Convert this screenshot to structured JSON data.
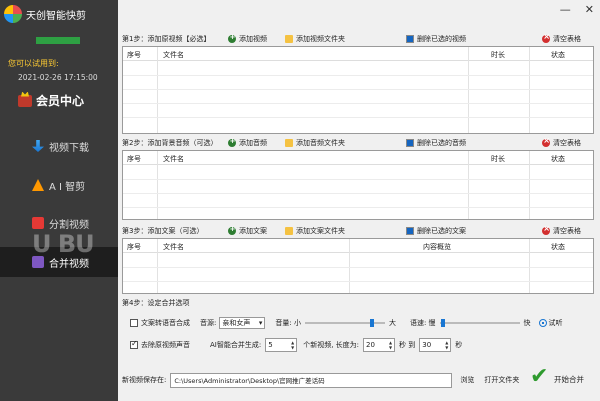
{
  "app": {
    "title": "天创智能快剪"
  },
  "sidebar": {
    "trial_label": "您可以试用到:",
    "trial_date": "2021-02-26 17:15:00",
    "vip_label": "会员中心",
    "items": [
      {
        "label": "视频下载",
        "icon": "download-icon"
      },
      {
        "label": "A I 智剪",
        "icon": "ai-icon"
      },
      {
        "label": "分割视频",
        "icon": "split-icon"
      },
      {
        "label": "合并视频",
        "icon": "merge-icon",
        "active": true
      }
    ],
    "watermark": "U BU"
  },
  "window": {
    "minimize": "—",
    "close": "✕"
  },
  "step1": {
    "label": "第1步：添加原视频【必选】",
    "add": "添加视频",
    "add_folder": "添加视频文件夹",
    "delete": "删除已选的视频",
    "clear": "清空表格",
    "columns": [
      "序号",
      "文件名",
      "时长",
      "状态"
    ]
  },
  "step2": {
    "label": "第2步：添加背景音频（可选）",
    "add": "添加音频",
    "add_folder": "添加音频文件夹",
    "delete": "删除已选的音频",
    "clear": "清空表格",
    "columns": [
      "序号",
      "文件名",
      "时长",
      "状态"
    ]
  },
  "step3": {
    "label": "第3步：添加文案（可选）",
    "add": "添加文案",
    "add_folder": "添加文案文件夹",
    "delete": "删除已选的文案",
    "clear": "清空表格",
    "columns": [
      "序号",
      "文件名",
      "内容概览",
      "状态"
    ]
  },
  "step4": {
    "label": "第4步：设定合并选项",
    "tts_label": "文案转语音合成",
    "voice_label": "音源:",
    "voice_value": "亲和女声",
    "volume_label": "音量: 小",
    "volume_max": "大",
    "volume_level": 0.85,
    "speed_label": "语速: 慢",
    "speed_max": "快",
    "speed_level": 0.02,
    "try_label": "试听",
    "remove_audio_label": "去除原视频声音",
    "ai_merge_label": "AI智能合并生成:",
    "ai_count": "5",
    "new_video_label": "个新视频, 长度为:",
    "len_from": "20",
    "to_label": "秒 到",
    "len_to": "30",
    "sec_label": "秒"
  },
  "save": {
    "label": "新视频保存在:",
    "path": "C:\\Users\\Administrator\\Desktop\\官网推广差话码",
    "browse": "浏览",
    "open_folder": "打开文件夹",
    "start": "开始合并"
  }
}
